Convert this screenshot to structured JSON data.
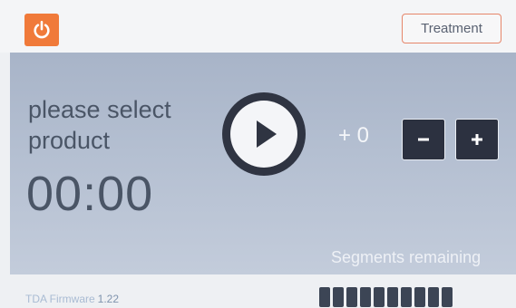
{
  "topbar": {
    "power_icon": "power-icon",
    "power_color": "#f07a3a",
    "treatment_label": "Treatment"
  },
  "main": {
    "prompt": "please select product",
    "timer": "00:00",
    "play_icon": "play-icon",
    "offset": "+ 0",
    "minus_label": "−",
    "plus_label": "+",
    "segments_label": "Segments remaining"
  },
  "footer": {
    "firmware_label": "TDA Firmware",
    "firmware_version": "1.22",
    "segments_remaining": 10,
    "segment_color": "#3c4555"
  }
}
